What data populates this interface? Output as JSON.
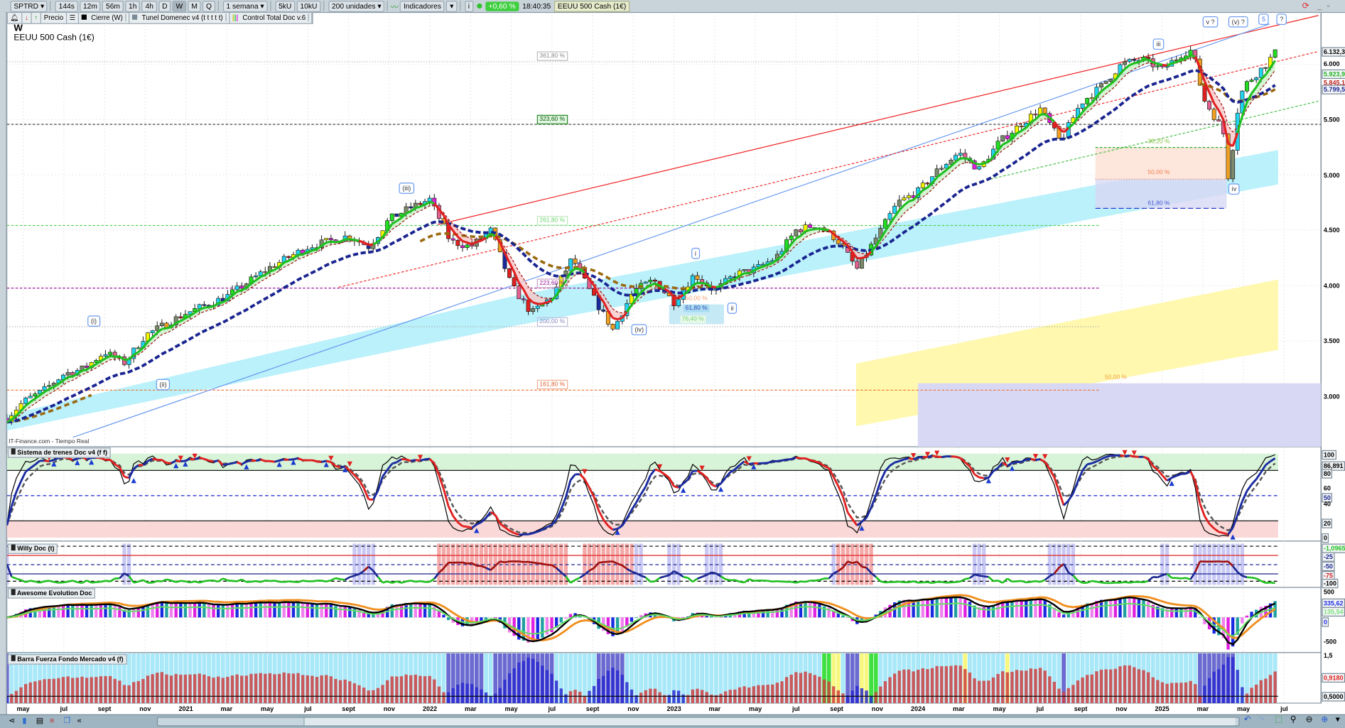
{
  "toolbar": {
    "symbol": "SPTRD ▾",
    "intervals": [
      "144s",
      "12m",
      "56m",
      "1h",
      "4h",
      "D",
      "W",
      "M",
      "Q"
    ],
    "active_interval": "W",
    "period": "1 semana ▾",
    "units": [
      "5kU",
      "10kU"
    ],
    "count": "200 unidades ▾",
    "indicators": "Indicadores",
    "indicators_menu": "▾",
    "info": "i",
    "change": "+0,60 %",
    "time": "18:40:35",
    "instrument": "EEUU 500 Cash (1€)"
  },
  "legend": {
    "price": "Precio",
    "close": "Cierre (W)",
    "tunnel": "Tunel Domenec v4 (t t t t t)",
    "control": "Control Total Doc v.6"
  },
  "chart": {
    "timeframe": "W",
    "title": "EEUU 500 Cash (1€)",
    "watermark": "IT-Finance.com - Tiempo Real",
    "price_axis": [
      "6.000",
      "5.500",
      "5.000",
      "4.500",
      "4.000",
      "3.500",
      "3.000"
    ],
    "price_tags": {
      "last": "6.132,3",
      "green": "5.923,9",
      "red": "5.845,1",
      "blue": "5.799,5"
    },
    "fib_labels": [
      "361,80 %",
      "323,60 %",
      "261,80 %",
      "223,60 %",
      "200,00 %",
      "161,80 %",
      "50,00 %",
      "38,20 %",
      "50,00 %",
      "61,80 %",
      "50,00 %",
      "61,80 %",
      "76,40 %"
    ],
    "wave_labels": [
      "(i)",
      "(ii)",
      "(iii)",
      "(iv)",
      "i",
      "ii",
      "iii",
      "iv",
      "v ?",
      "(v) ?",
      "5",
      "?"
    ]
  },
  "panels": {
    "trenes": {
      "title": "Sistema de trenes Doc v4 (f f)",
      "axis": [
        "100",
        "86,891",
        "80",
        "60",
        "50",
        "40",
        "20",
        "0"
      ]
    },
    "willy": {
      "title": "Willy Doc (t)",
      "axis": [
        "-1,0965",
        "-25",
        "-50",
        "-75",
        "-100"
      ]
    },
    "awesome": {
      "title": "Awesome Evolution Doc",
      "axis": [
        "500",
        "335,62",
        "135,54",
        "0",
        "-500"
      ]
    },
    "barra": {
      "title": "Barra Fuerza Fondo Mercado v4 (f)",
      "axis": [
        "1,5",
        "0,9180",
        "0,5000"
      ]
    }
  },
  "colors": {
    "up": "#22d3ee",
    "bull_ema": "#1fbf1f",
    "bear_ema": "#e02020",
    "slow_ema": "#1a2590",
    "brown": "#9a6a10"
  },
  "chart_data": {
    "type": "candlestick",
    "title": "EEUU 500 Cash (1€) W",
    "x_unit": "months since May 2020",
    "time_axis": [
      [
        0,
        "may"
      ],
      [
        2,
        "jul"
      ],
      [
        4,
        "sept"
      ],
      [
        6,
        "nov"
      ],
      [
        8,
        "2021"
      ],
      [
        10,
        "mar"
      ],
      [
        12,
        "may"
      ],
      [
        14,
        "jul"
      ],
      [
        16,
        "sept"
      ],
      [
        18,
        "nov"
      ],
      [
        20,
        "2022"
      ],
      [
        22,
        "mar"
      ],
      [
        24,
        "may"
      ],
      [
        26,
        "jul"
      ],
      [
        28,
        "sept"
      ],
      [
        30,
        "nov"
      ],
      [
        32,
        "2023"
      ],
      [
        34,
        "mar"
      ],
      [
        36,
        "may"
      ],
      [
        38,
        "jul"
      ],
      [
        40,
        "sept"
      ],
      [
        42,
        "nov"
      ],
      [
        44,
        "2024"
      ],
      [
        46,
        "mar"
      ],
      [
        48,
        "may"
      ],
      [
        50,
        "jul"
      ],
      [
        52,
        "sept"
      ],
      [
        54,
        "nov"
      ],
      [
        56,
        "2025"
      ],
      [
        58,
        "mar"
      ],
      [
        60,
        "may"
      ],
      [
        62,
        "jul"
      ]
    ],
    "ylim": [
      2600,
      6400
    ],
    "price_path": [
      [
        -0.8,
        2800
      ],
      [
        0,
        2950
      ],
      [
        1,
        3050
      ],
      [
        2,
        3200
      ],
      [
        3,
        3250
      ],
      [
        4,
        3400
      ],
      [
        5,
        3300
      ],
      [
        6,
        3550
      ],
      [
        8,
        3750
      ],
      [
        10,
        3900
      ],
      [
        12,
        4150
      ],
      [
        14,
        4350
      ],
      [
        16,
        4450
      ],
      [
        17,
        4350
      ],
      [
        18,
        4600
      ],
      [
        19,
        4700
      ],
      [
        20,
        4780
      ],
      [
        21,
        4400
      ],
      [
        22,
        4350
      ],
      [
        23,
        4500
      ],
      [
        24,
        4000
      ],
      [
        25,
        3750
      ],
      [
        26,
        3900
      ],
      [
        27,
        4250
      ],
      [
        28,
        3900
      ],
      [
        29,
        3600
      ],
      [
        30,
        3950
      ],
      [
        31,
        4050
      ],
      [
        32,
        3850
      ],
      [
        33,
        4100
      ],
      [
        34,
        3950
      ],
      [
        35,
        4100
      ],
      [
        36,
        4150
      ],
      [
        37,
        4250
      ],
      [
        38,
        4500
      ],
      [
        39,
        4550
      ],
      [
        40,
        4420
      ],
      [
        41,
        4150
      ],
      [
        42,
        4450
      ],
      [
        43,
        4750
      ],
      [
        44,
        4850
      ],
      [
        45,
        5050
      ],
      [
        46,
        5200
      ],
      [
        47,
        5050
      ],
      [
        48,
        5300
      ],
      [
        49,
        5450
      ],
      [
        50,
        5600
      ],
      [
        51,
        5300
      ],
      [
        52,
        5650
      ],
      [
        53,
        5800
      ],
      [
        54,
        6000
      ],
      [
        55,
        6050
      ],
      [
        56,
        5950
      ],
      [
        57,
        6100
      ],
      [
        57.5,
        6130
      ],
      [
        58,
        5700
      ],
      [
        59,
        5400
      ],
      [
        59.3,
        4900
      ],
      [
        59.6,
        5500
      ],
      [
        60,
        5800
      ],
      [
        61,
        5980
      ],
      [
        61.7,
        6132.3
      ]
    ]
  }
}
